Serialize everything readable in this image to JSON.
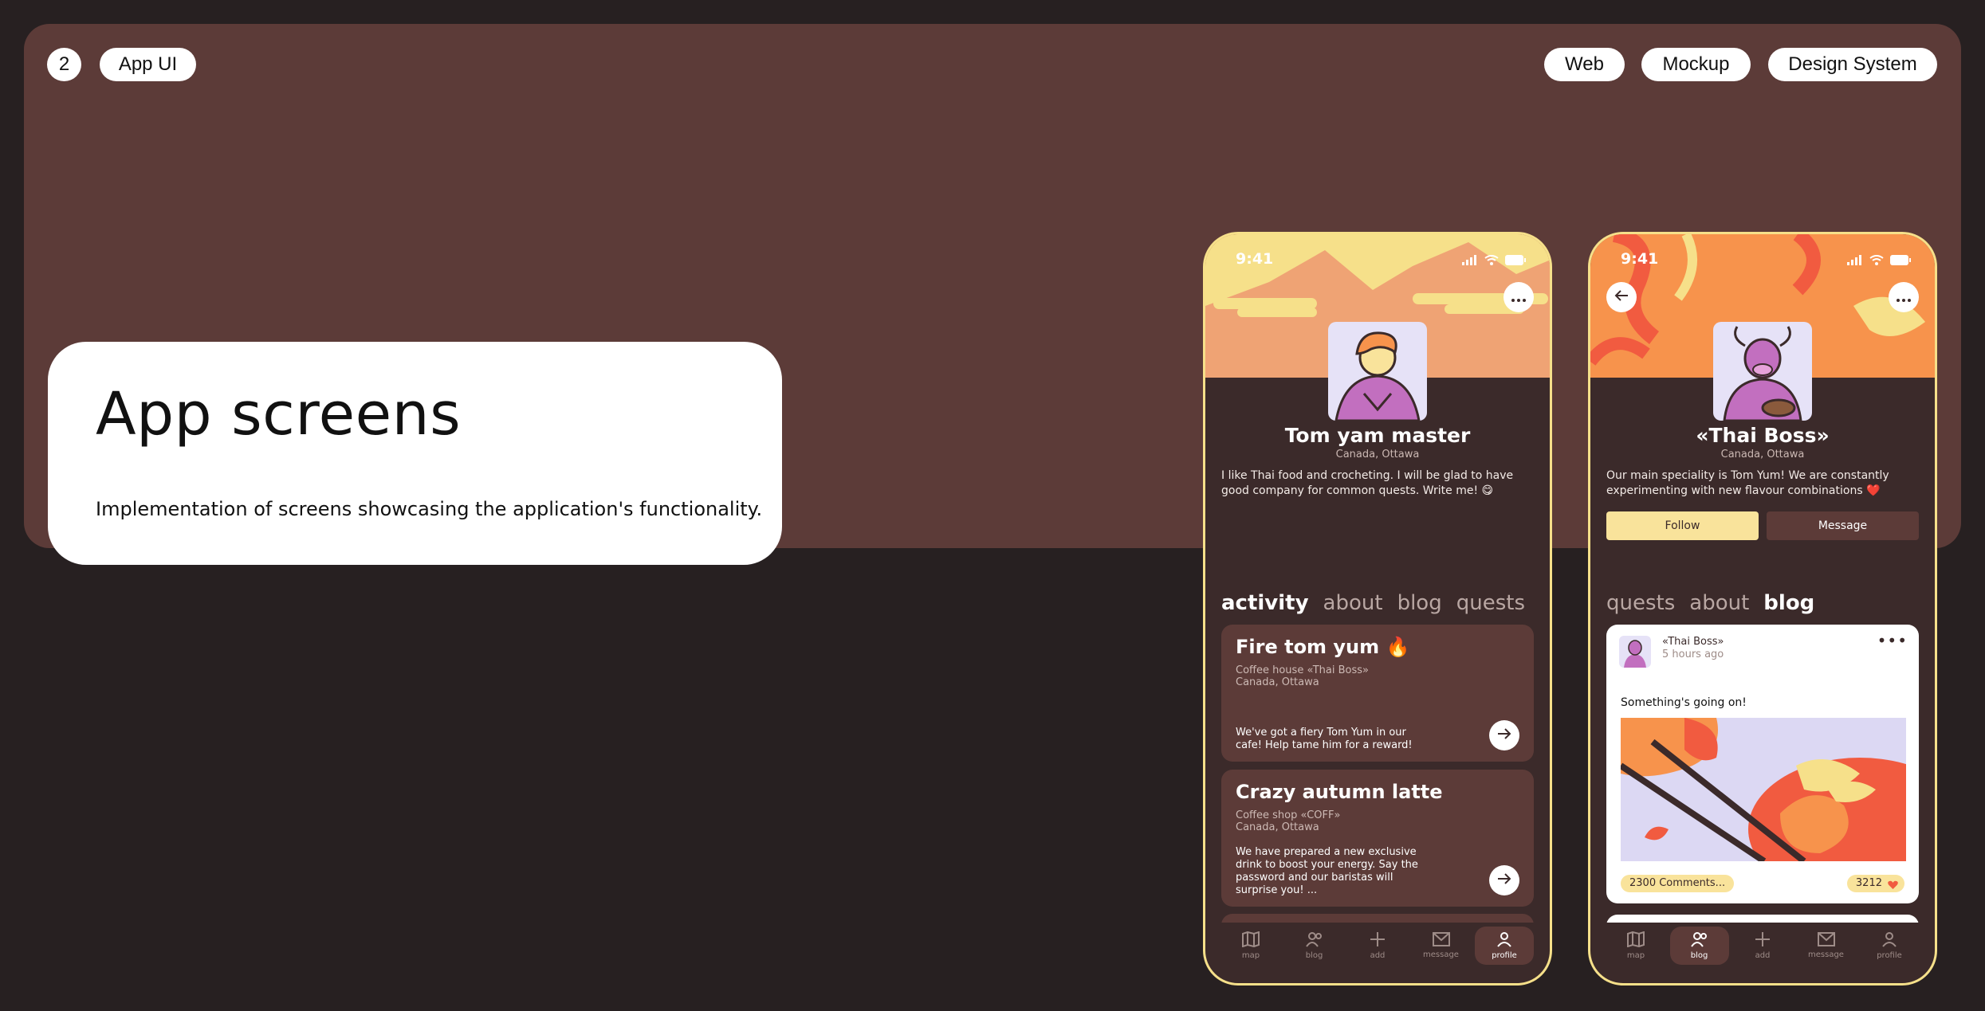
{
  "header": {
    "number": "2",
    "category": "App UI",
    "tags": [
      "Web",
      "Mockup",
      "Design System"
    ]
  },
  "intro": {
    "title": "App screens",
    "description": "Implementation of screens showcasing the application's functionality."
  },
  "screen1": {
    "time": "9:41",
    "name": "Tom yam master",
    "location": "Canada, Ottawa",
    "bio": "I like Thai food and crocheting. I will be glad to have good company for common quests. Write me! 😋",
    "tabs": [
      "activity",
      "about",
      "blog",
      "quests"
    ],
    "active_tab": "activity",
    "cards": [
      {
        "title": "Fire tom yum 🔥",
        "place": "Coffee house «Thai Boss»",
        "location": "Canada, Ottawa",
        "description": "We've got a fiery Tom Yum in our cafe! Help tame him for a reward!"
      },
      {
        "title": "Crazy autumn latte",
        "place": "Coffee shop «COFF»",
        "location": "Canada, Ottawa",
        "description": "We have prepared a new exclusive drink to boost your energy. Say the password and our baristas will surprise you! ..."
      }
    ],
    "nav": [
      "map",
      "blog",
      "add",
      "message",
      "profile"
    ],
    "active_nav": "profile"
  },
  "screen2": {
    "time": "9:41",
    "name": "«Thai Boss»",
    "location": "Canada, Ottawa",
    "bio": "Our main speciality is Tom Yum! We are constantly experimenting with new flavour combinations ❤️",
    "follow_label": "Follow",
    "message_label": "Message",
    "tabs": [
      "quests",
      "about",
      "blog"
    ],
    "active_tab": "blog",
    "post": {
      "author": "«Thai Boss»",
      "time_ago": "5 hours ago",
      "caption": "Something's going on!",
      "comments": "2300 Comments...",
      "likes": "3212"
    },
    "nav": [
      "map",
      "blog",
      "add",
      "message",
      "profile"
    ],
    "active_nav": "blog"
  },
  "colors": {
    "background": "#272021",
    "panel": "#5c3b38",
    "phone_border": "#f6e08a",
    "accent_yellow": "#f9e39b",
    "accent_orange": "#f7934c"
  }
}
